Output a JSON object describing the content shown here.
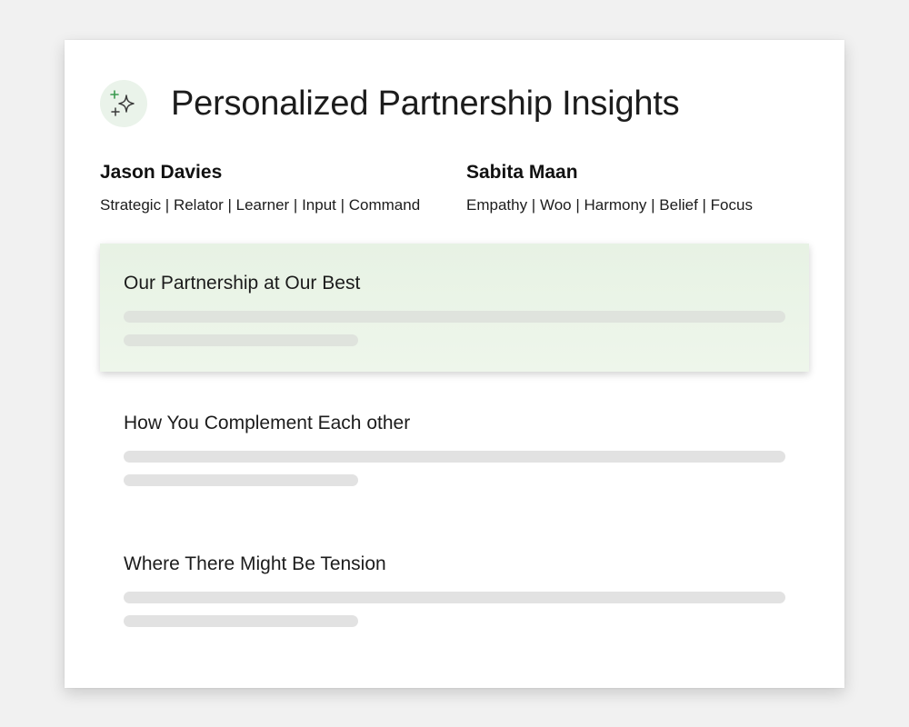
{
  "header": {
    "title": "Personalized Partnership Insights",
    "icon": "sparkle-icon"
  },
  "people": [
    {
      "name": "Jason Davies",
      "strengths": "Strategic | Relator | Learner | Input | Command"
    },
    {
      "name": "Sabita Maan",
      "strengths": "Empathy | Woo | Harmony | Belief | Focus"
    }
  ],
  "sections": [
    {
      "title": "Our Partnership at Our Best",
      "highlighted": true
    },
    {
      "title": "How You Complement Each other",
      "highlighted": false
    },
    {
      "title": "Where There Might Be Tension",
      "highlighted": false
    }
  ],
  "colors": {
    "page_background": "#f1f1f1",
    "card_background": "#ffffff",
    "highlight_background": "#e7f2e4",
    "icon_badge_background": "#eaf3ea",
    "accent_green": "#3a9a4f",
    "placeholder_gray": "#e2e2e2"
  }
}
